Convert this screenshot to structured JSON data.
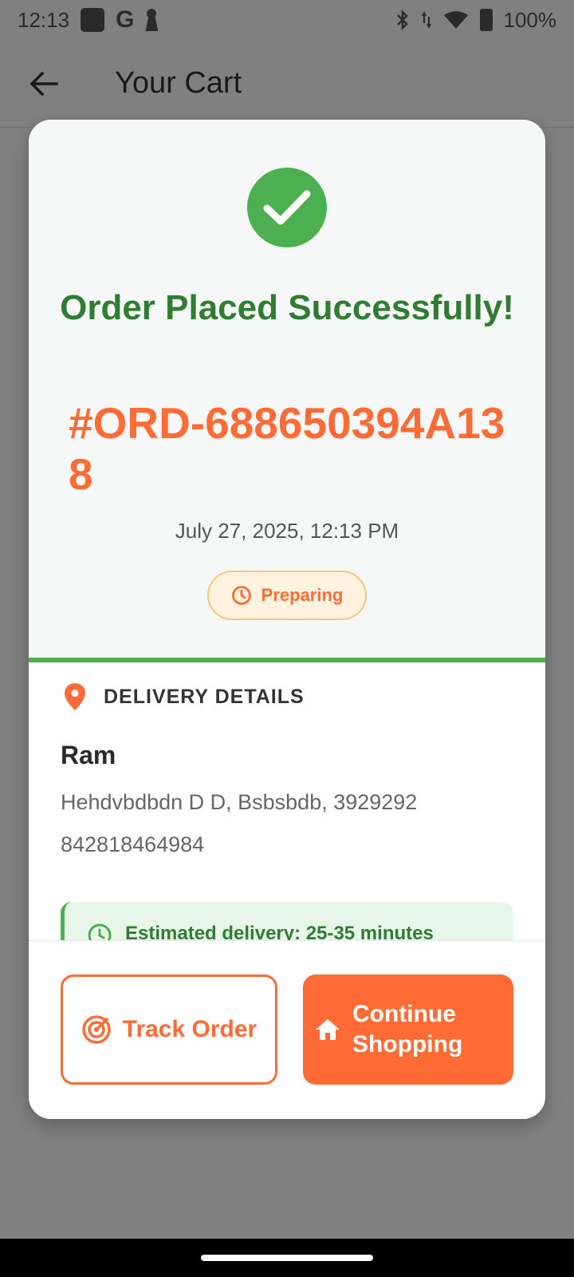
{
  "status_bar": {
    "time": "12:13",
    "battery": "100%"
  },
  "app_bar": {
    "title": "Your Cart"
  },
  "dialog": {
    "success_title": "Order Placed Successfully!",
    "order_id": "#ORD-688650394A138",
    "order_date": "July 27, 2025, 12:13 PM",
    "status_label": "Preparing",
    "delivery": {
      "section_title": "DELIVERY DETAILS",
      "name": "Ram",
      "address": "Hehdvbdbdn D D, Bsbsbdb, 3929292",
      "phone": "842818464984",
      "estimate": "Estimated delivery: 25-35 minutes"
    },
    "buttons": {
      "track": "Track Order",
      "continue": "Continue Shopping"
    }
  },
  "colors": {
    "success_green": "#4caf50",
    "dark_green": "#2e7d32",
    "accent_orange": "#ff6b35",
    "chip_bg": "#fff3e0"
  },
  "icons": [
    "check-icon",
    "clock-icon",
    "location-pin-icon",
    "radar-icon",
    "home-icon",
    "back-arrow-icon"
  ]
}
